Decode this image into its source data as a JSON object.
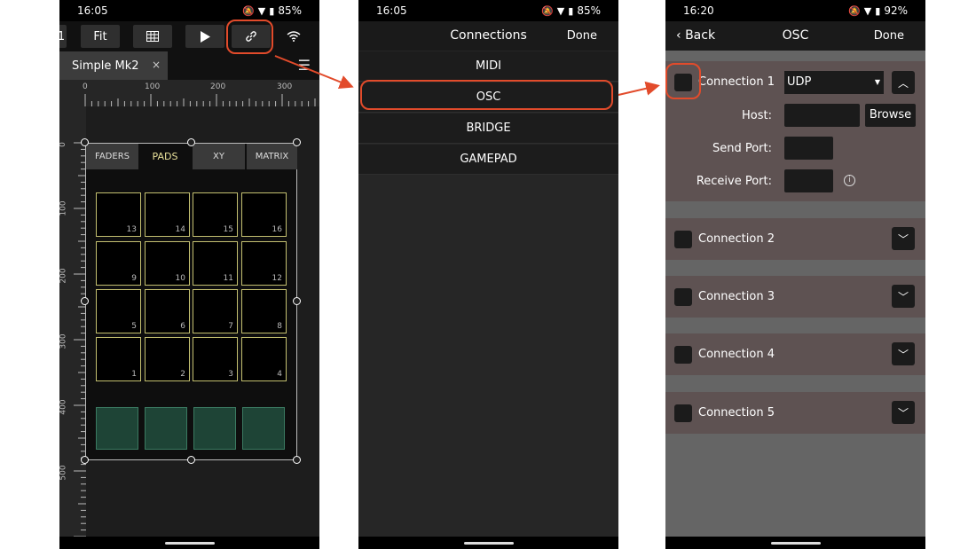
{
  "phone1": {
    "status": {
      "time": "16:05",
      "battery": "85%"
    },
    "toolbar": {
      "page_num": "1",
      "fit_label": "Fit"
    },
    "doc_tab": {
      "name": "Simple Mk2",
      "close": "×"
    },
    "ruler": {
      "h_ticks": [
        "0",
        "100",
        "200",
        "300"
      ],
      "v_ticks": [
        "0",
        "100",
        "200",
        "300",
        "400",
        "500"
      ]
    },
    "layout_tabs": [
      "FADERS",
      "PADS",
      "XY",
      "MATRIX"
    ],
    "pads": [
      "13",
      "14",
      "15",
      "16",
      "9",
      "10",
      "11",
      "12",
      "5",
      "6",
      "7",
      "8",
      "1",
      "2",
      "3",
      "4"
    ],
    "green_pad_count": 4
  },
  "phone2": {
    "status": {
      "time": "16:05",
      "battery": "85%"
    },
    "header": {
      "title": "Connections",
      "done": "Done"
    },
    "items": [
      "MIDI",
      "OSC",
      "BRIDGE",
      "GAMEPAD"
    ]
  },
  "phone3": {
    "status": {
      "time": "16:20",
      "battery": "92%"
    },
    "header": {
      "back": "Back",
      "title": "OSC",
      "done": "Done"
    },
    "connection1": {
      "label": "Connection 1",
      "protocol": "UDP",
      "host_label": "Host:",
      "browse_label": "Browse",
      "send_port_label": "Send Port:",
      "receive_port_label": "Receive Port:"
    },
    "connections": [
      "Connection 2",
      "Connection 3",
      "Connection 4",
      "Connection 5"
    ]
  },
  "colors": {
    "callout": "#e24b2b",
    "pad_border": "#c4c070",
    "active_tab": "#e8e09a",
    "conn_bg": "#5e5252"
  }
}
